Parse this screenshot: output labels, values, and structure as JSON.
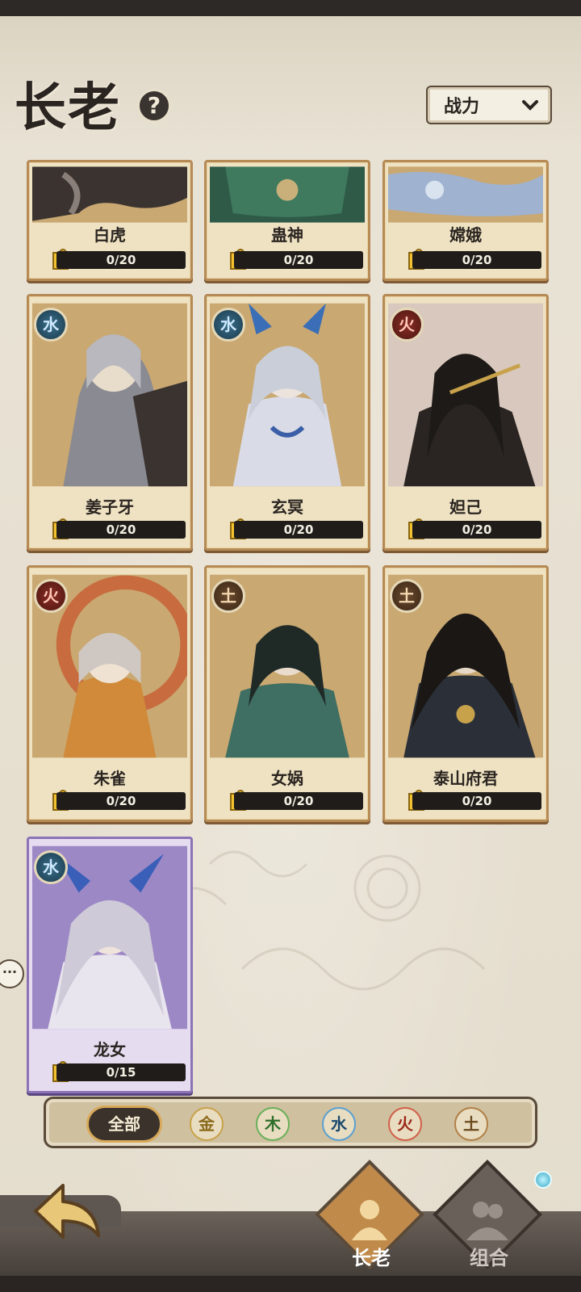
{
  "header": {
    "title": "长老",
    "help_icon": "?",
    "sort": {
      "selected": "战力"
    }
  },
  "cards": [
    {
      "name": "白虎",
      "progress": "0/20",
      "element": "",
      "progress_value": 0,
      "progress_max": 20
    },
    {
      "name": "蛊神",
      "progress": "0/20",
      "element": "",
      "progress_value": 0,
      "progress_max": 20
    },
    {
      "name": "嫦娥",
      "progress": "0/20",
      "element": "",
      "progress_value": 0,
      "progress_max": 20
    },
    {
      "name": "姜子牙",
      "progress": "0/20",
      "element": "水",
      "progress_value": 0,
      "progress_max": 20
    },
    {
      "name": "玄冥",
      "progress": "0/20",
      "element": "水",
      "progress_value": 0,
      "progress_max": 20
    },
    {
      "name": "妲己",
      "progress": "0/20",
      "element": "火",
      "progress_value": 0,
      "progress_max": 20
    },
    {
      "name": "朱雀",
      "progress": "0/20",
      "element": "火",
      "progress_value": 0,
      "progress_max": 20
    },
    {
      "name": "女娲",
      "progress": "0/20",
      "element": "土",
      "progress_value": 0,
      "progress_max": 20
    },
    {
      "name": "泰山府君",
      "progress": "0/20",
      "element": "土",
      "progress_value": 0,
      "progress_max": 20
    },
    {
      "name": "龙女",
      "progress": "0/15",
      "element": "水",
      "progress_value": 0,
      "progress_max": 15
    }
  ],
  "filters": {
    "all": "全部",
    "metal": "金",
    "wood": "木",
    "water": "水",
    "fire": "火",
    "earth": "土"
  },
  "nav": {
    "elders": "长老",
    "combo": "组合"
  },
  "chat_icon": "···",
  "colors": {
    "water": "#1a3a4c",
    "fire": "#4c1611",
    "earth": "#3a2616",
    "accent_gold": "#d8a95a",
    "purple_card": "#8c73b6"
  }
}
